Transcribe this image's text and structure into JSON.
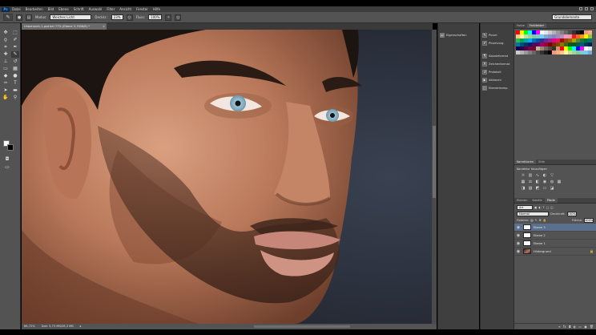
{
  "menubar": {
    "logo": "Ps",
    "items": [
      "Datei",
      "Bearbeiten",
      "Bild",
      "Ebene",
      "Schrift",
      "Auswahl",
      "Filter",
      "Ansicht",
      "Fenster",
      "Hilfe"
    ]
  },
  "options": {
    "modus_label": "Modus:",
    "modus_value": "Weiches Licht",
    "deckr_label": "Deckkr.:",
    "deckr_value": "23%",
    "fluss_label": "Fluss:",
    "fluss_value": "100%",
    "workspace": "Grundelemente"
  },
  "document": {
    "tab_title": "Unbenannt-1.psd bei 77% (Ebene 3, RGB/8) *",
    "status_zoom": "66,72%",
    "status_doc": "Dok: 5,75 MB/28,3 MB"
  },
  "dock1": {
    "items": [
      {
        "label": "Eigenschaften",
        "icon": "properties-icon"
      }
    ]
  },
  "dock2": {
    "items": [
      {
        "label": "Pinsel",
        "icon": "brush-icon"
      },
      {
        "label": "Pinselvorg.",
        "icon": "brush-presets-icon"
      },
      {
        "label": "Absatzformat",
        "icon": "paragraph-style-icon"
      },
      {
        "label": "Zeichenformat",
        "icon": "character-style-icon"
      },
      {
        "label": "Protokoll",
        "icon": "history-icon"
      },
      {
        "label": "Aktionen",
        "icon": "actions-icon"
      },
      {
        "label": "Ebenenkomp.",
        "icon": "layer-comps-icon"
      }
    ]
  },
  "panels": {
    "color_tab": "Farbe",
    "swatches_tab": "Farbfelder",
    "adjust_tab": "Korrekturen",
    "styles_tab": "Stile",
    "adjust_title": "Korrektur hinzufügen",
    "layers_tabs": [
      "Ebenen",
      "Kanäle",
      "Pfade"
    ],
    "filter_type": "Art",
    "blend_mode": "Normal",
    "opacity_label": "Deckkraft:",
    "opacity_value": "100%",
    "lock_label": "Fixieren:",
    "fill_label": "Fläche:",
    "fill_value": "100%",
    "layers": [
      {
        "name": "Ebene 3",
        "selected": true
      },
      {
        "name": "Ebene 2",
        "selected": false
      },
      {
        "name": "Ebene 1",
        "selected": false
      },
      {
        "name": "Hintergrund",
        "selected": false
      }
    ]
  },
  "colors": {
    "ui_dark": "#535353",
    "selection": "#5b6f8f",
    "ps_blue": "#31a8ff"
  }
}
